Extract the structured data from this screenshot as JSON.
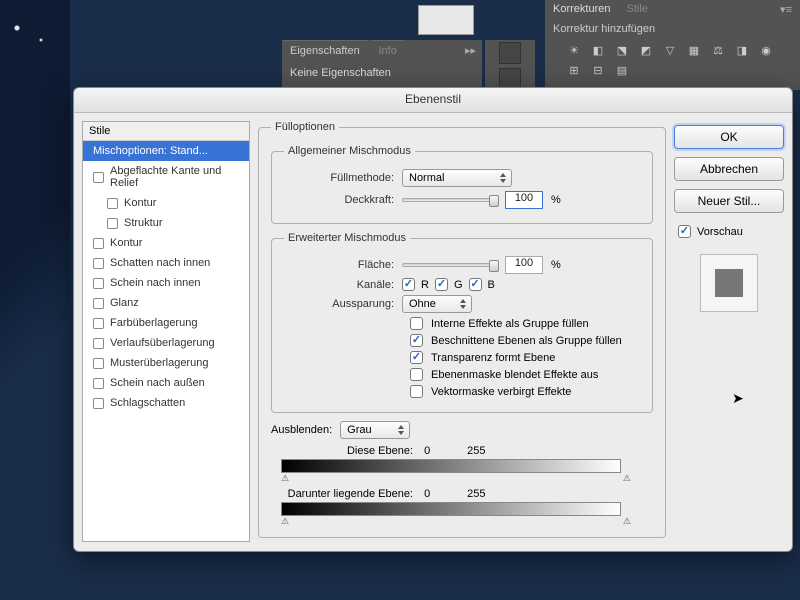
{
  "background_panels": {
    "properties": {
      "tab1": "Eigenschaften",
      "tab2": "Info",
      "body": "Keine Eigenschaften"
    },
    "adjustments": {
      "tab1": "Korrekturen",
      "tab2": "Stile",
      "subtitle": "Korrektur hinzufügen"
    }
  },
  "dialog": {
    "title": "Ebenenstil",
    "styles_header": "Stile",
    "styles": [
      {
        "label": "Mischoptionen: Stand...",
        "selected": true,
        "checkbox": false
      },
      {
        "label": "Abgeflachte Kante und Relief",
        "checkbox": true
      },
      {
        "label": "Kontur",
        "checkbox": true,
        "sub": true
      },
      {
        "label": "Struktur",
        "checkbox": true,
        "sub": true
      },
      {
        "label": "Kontur",
        "checkbox": true
      },
      {
        "label": "Schatten nach innen",
        "checkbox": true
      },
      {
        "label": "Schein nach innen",
        "checkbox": true
      },
      {
        "label": "Glanz",
        "checkbox": true
      },
      {
        "label": "Farbüberlagerung",
        "checkbox": true
      },
      {
        "label": "Verlaufsüberlagerung",
        "checkbox": true
      },
      {
        "label": "Musterüberlagerung",
        "checkbox": true
      },
      {
        "label": "Schein nach außen",
        "checkbox": true
      },
      {
        "label": "Schlagschatten",
        "checkbox": true
      }
    ],
    "fill_options": {
      "legend": "Fülloptionen",
      "general": {
        "legend": "Allgemeiner Mischmodus",
        "mode_label": "Füllmethode:",
        "mode_value": "Normal",
        "opacity_label": "Deckkraft:",
        "opacity_value": "100",
        "pct": "%"
      },
      "advanced": {
        "legend": "Erweiterter Mischmodus",
        "fill_label": "Fläche:",
        "fill_value": "100",
        "pct": "%",
        "channels_label": "Kanäle:",
        "ch_r": "R",
        "ch_g": "G",
        "ch_b": "B",
        "knockout_label": "Aussparung:",
        "knockout_value": "Ohne",
        "opt1": "Interne Effekte als Gruppe füllen",
        "opt2": "Beschnittene Ebenen als Gruppe füllen",
        "opt3": "Transparenz formt Ebene",
        "opt4": "Ebenenmaske blendet Effekte aus",
        "opt5": "Vektormaske verbirgt Effekte"
      },
      "blend_if": {
        "label": "Ausblenden:",
        "value": "Grau",
        "this_layer": "Diese Ebene:",
        "under_layer": "Darunter liegende Ebene:",
        "v0": "0",
        "v255": "255"
      }
    },
    "buttons": {
      "ok": "OK",
      "cancel": "Abbrechen",
      "new_style": "Neuer Stil...",
      "preview": "Vorschau"
    }
  }
}
